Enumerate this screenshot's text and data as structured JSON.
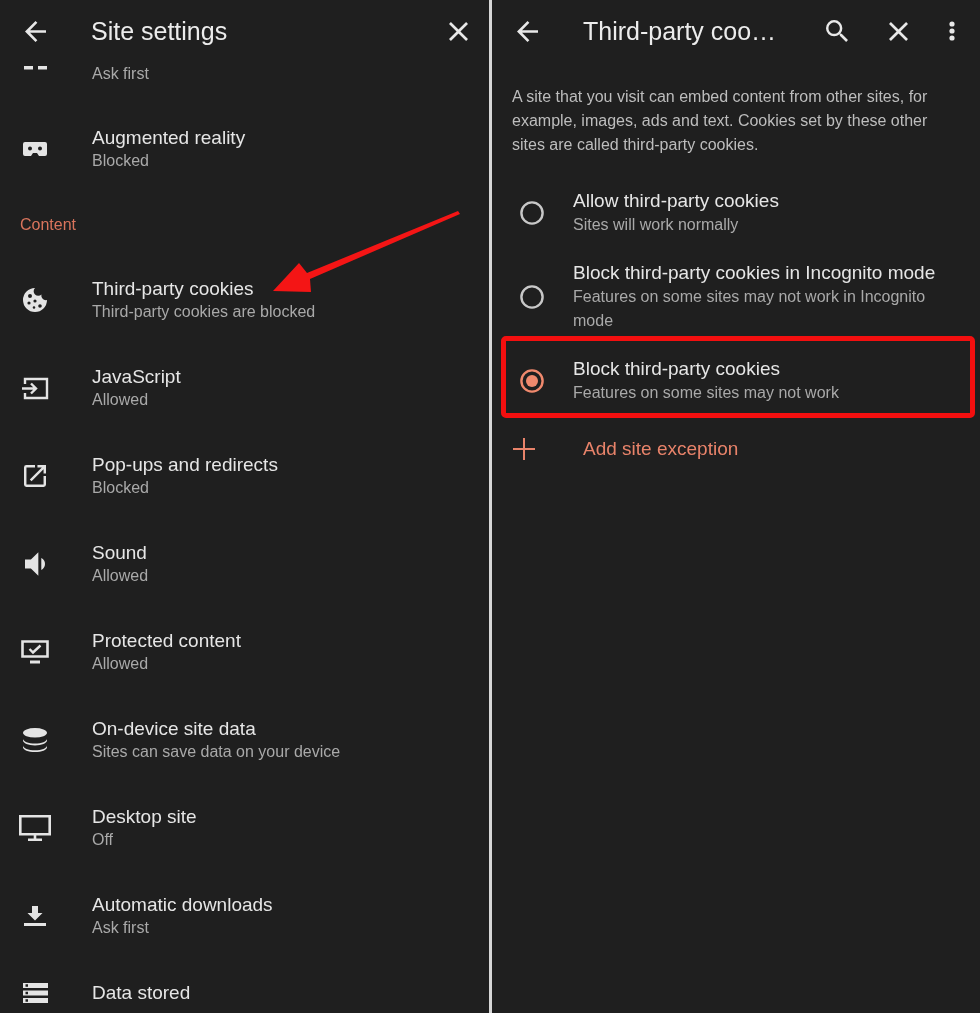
{
  "left_panel": {
    "header": {
      "title": "Site settings"
    },
    "items": [
      {
        "kind": "setting",
        "subtitle": "Ask first",
        "annotated": false
      },
      {
        "kind": "setting",
        "title": "Augmented reality",
        "subtitle": "Blocked",
        "annotated": false
      },
      {
        "kind": "section",
        "title": "Content"
      },
      {
        "kind": "setting",
        "title": "Third-party cookies",
        "subtitle": "Third-party cookies are blocked",
        "annotated": true
      },
      {
        "kind": "setting",
        "title": "JavaScript",
        "subtitle": "Allowed",
        "annotated": false
      },
      {
        "kind": "setting",
        "title": "Pop-ups and redirects",
        "subtitle": "Blocked",
        "annotated": false
      },
      {
        "kind": "setting",
        "title": "Sound",
        "subtitle": "Allowed",
        "annotated": false
      },
      {
        "kind": "setting",
        "title": "Protected content",
        "subtitle": "Allowed",
        "annotated": false
      },
      {
        "kind": "setting",
        "title": "On-device site data",
        "subtitle": "Sites can save data on your device",
        "annotated": false
      },
      {
        "kind": "setting",
        "title": "Desktop site",
        "subtitle": "Off",
        "annotated": false
      },
      {
        "kind": "setting",
        "title": "Automatic downloads",
        "subtitle": "Ask first",
        "annotated": false
      },
      {
        "kind": "setting",
        "title": "Data stored",
        "annotated": false
      }
    ]
  },
  "right_panel": {
    "header": {
      "title": "Third-party coo…"
    },
    "description": "A site that you visit can embed content from other sites, for example, images, ads and text. Cookies set by these other sites are called third-party cookies.",
    "options": [
      {
        "title": "Allow third-party cookies",
        "subtitle": "Sites will work normally",
        "selected": false,
        "highlighted": false
      },
      {
        "title": "Block third-party cookies in Incognito mode",
        "subtitle": "Features on some sites may not work in Incognito mode",
        "selected": false,
        "highlighted": false
      },
      {
        "title": "Block third-party cookies",
        "subtitle": "Features on some sites may not work",
        "selected": true,
        "highlighted": true
      }
    ],
    "action": {
      "label": "Add site exception"
    }
  }
}
